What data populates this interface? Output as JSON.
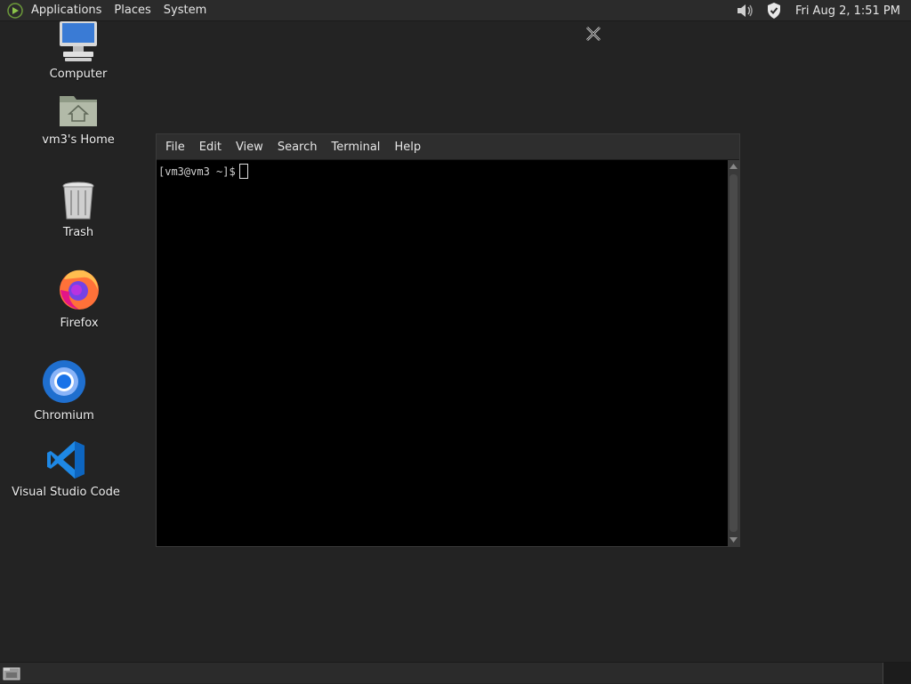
{
  "top_panel": {
    "menu": [
      "Applications",
      "Places",
      "System"
    ],
    "clock": "Fri Aug  2,  1:51 PM",
    "tray_icons": [
      "volume-icon",
      "shield-icon"
    ]
  },
  "desktop": {
    "icons": [
      {
        "label": "Computer",
        "icon": "computer-icon"
      },
      {
        "label": "vm3's Home",
        "icon": "home-folder-icon"
      },
      {
        "label": "Trash",
        "icon": "trash-icon"
      },
      {
        "label": "Firefox",
        "icon": "firefox-icon"
      },
      {
        "label": "Chromium",
        "icon": "chromium-icon"
      },
      {
        "label": "Visual Studio Code",
        "icon": "vscode-icon"
      }
    ]
  },
  "terminal": {
    "menu": [
      "File",
      "Edit",
      "View",
      "Search",
      "Terminal",
      "Help"
    ],
    "prompt": "[vm3@vm3 ~]$"
  },
  "colors": {
    "panel": "#2b2b2b",
    "desktop": "#232323",
    "terminal_bg": "#000000",
    "vscode_blue": "#1e88e5"
  }
}
